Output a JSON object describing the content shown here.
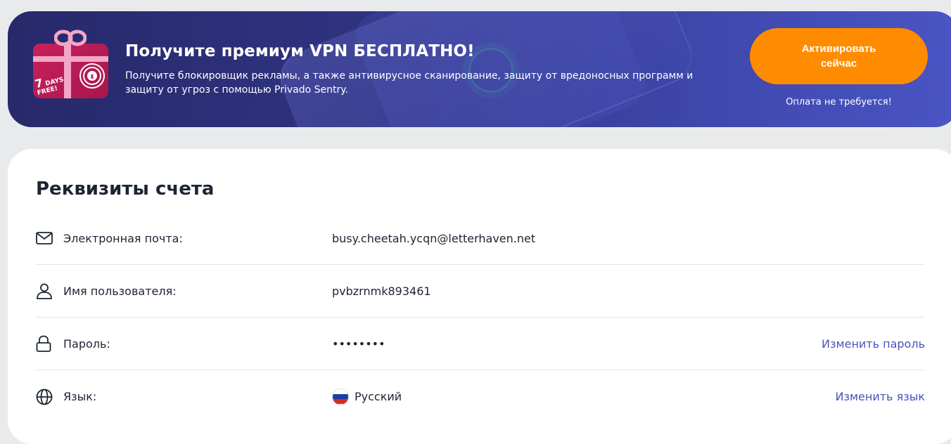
{
  "promo": {
    "title": "Получите премиум VPN БЕСПЛАТНО!",
    "description": "Получите блокировщик рекламы, а также антивирусное сканирование, защиту от вредоносных программ и защиту от угроз с помощью Privado Sentry.",
    "gift_badge_number": "7",
    "gift_badge_line1": "DAYS",
    "gift_badge_line2": "FREE!",
    "cta_label": "Активировать сейчас",
    "note": "Оплата не требуется!",
    "accent_color": "#ff8c00",
    "gift_icon": "gift-icon"
  },
  "account": {
    "title": "Реквизиты счета",
    "rows": [
      {
        "icon": "envelope-icon",
        "label": "Электронная почта:",
        "value": "busy.cheetah.ycqn@letterhaven.net",
        "action": ""
      },
      {
        "icon": "user-icon",
        "label": "Имя пользователя:",
        "value": "pvbzrnmk893461",
        "action": ""
      },
      {
        "icon": "lock-icon",
        "label": "Пароль:",
        "value": "••••••••",
        "action": "Изменить пароль"
      },
      {
        "icon": "globe-icon",
        "label": "Язык:",
        "value": "Русский",
        "value_icon": "russia-flag-icon",
        "action": "Изменить язык"
      }
    ],
    "link_color": "#4a53b8"
  }
}
